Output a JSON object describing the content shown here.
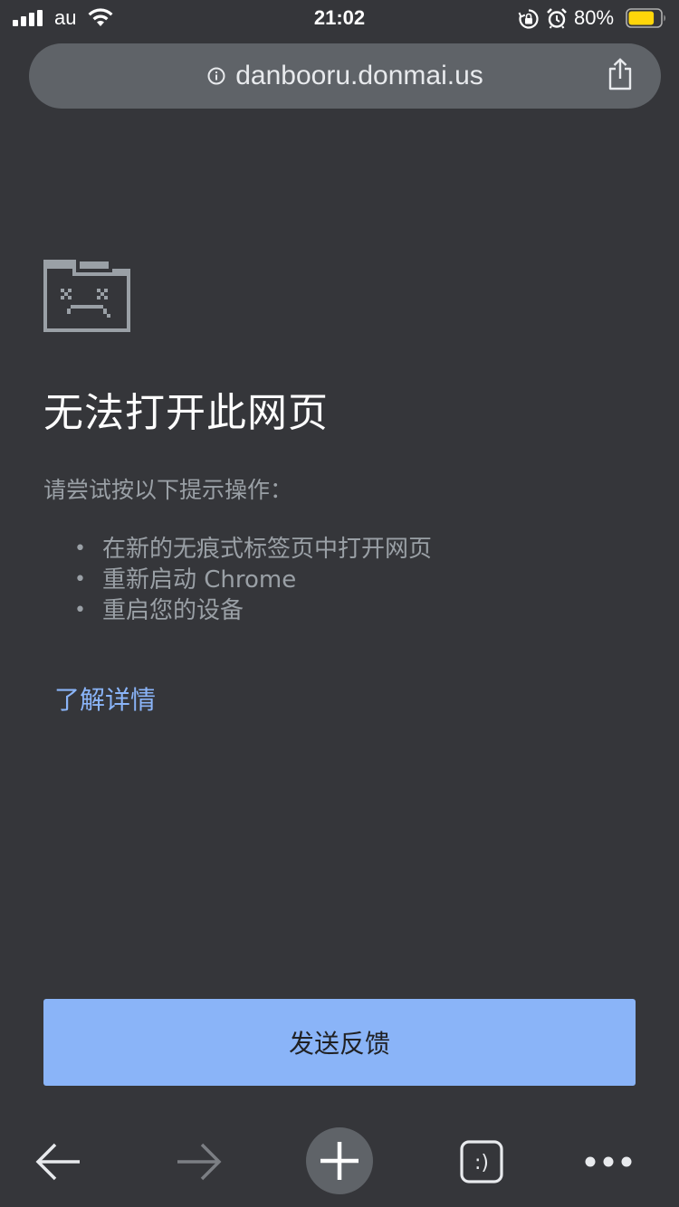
{
  "status_bar": {
    "carrier": "au",
    "time": "21:02",
    "battery_percent": "80%",
    "signal_strength_bars": 4,
    "battery_level": 0.8,
    "battery_color": "#ffd60a"
  },
  "address_bar": {
    "url": "danbooru.donmai.us",
    "info_icon": "info-icon",
    "share_icon": "share-icon"
  },
  "error_page": {
    "icon": "sad-tab-icon",
    "title": "无法打开此网页",
    "suggestion_intro": "请尝试按以下提示操作：",
    "bullet": "•",
    "suggestions": [
      "在新的无痕式标签页中打开网页",
      "重新启动 Chrome",
      "重启您的设备"
    ],
    "learn_more": "了解详情",
    "feedback_button": "发送反馈"
  },
  "toolbar": {
    "tab_count": ":)",
    "icons": [
      "back-arrow-icon",
      "forward-arrow-icon",
      "new-tab-plus-icon",
      "tab-switcher-icon",
      "more-menu-icon"
    ]
  },
  "colors": {
    "background": "#35363a",
    "address_bar": "#5f6368",
    "title_text": "#ffffff",
    "body_text": "#9aa0a6",
    "link": "#8ab4f8",
    "button": "#8ab4f8"
  }
}
